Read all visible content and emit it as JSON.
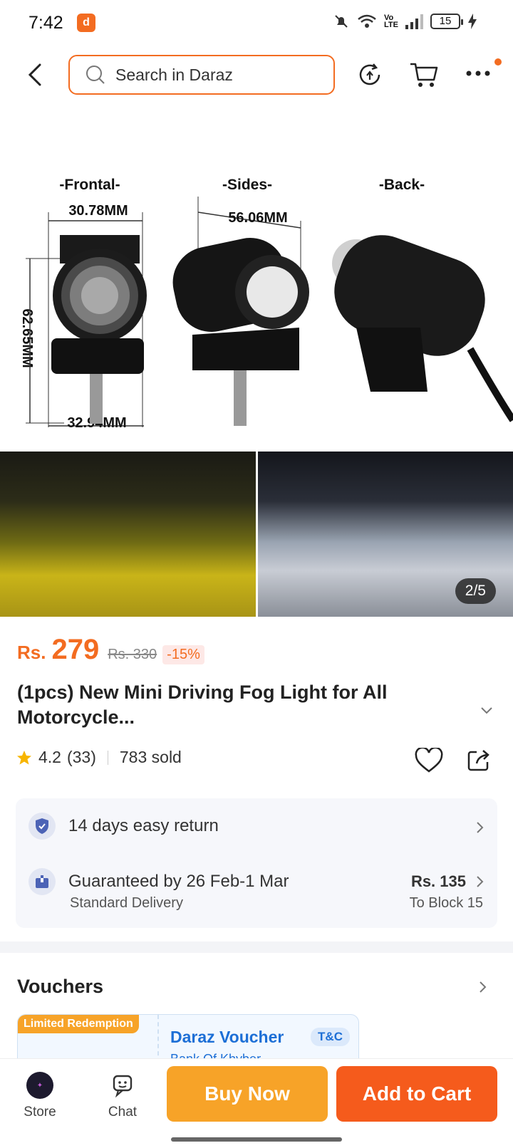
{
  "status_bar": {
    "time": "7:42",
    "battery": "15",
    "icons": [
      "mute-icon",
      "wifi-icon",
      "volte-icon",
      "signal-icon",
      "battery-icon",
      "charging-icon"
    ]
  },
  "nav": {
    "search_placeholder": "Search in Daraz",
    "icons": [
      "back-arrow-icon",
      "search-icon",
      "history-icon",
      "cart-icon",
      "more-icon"
    ]
  },
  "gallery": {
    "labels": {
      "frontal": "-Frontal-",
      "sides": "-Sides-",
      "back": "-Back-"
    },
    "dimensions": {
      "front_width": "30.78MM",
      "side_length": "56.06MM",
      "height": "62.65MM",
      "bracket_width": "32.94MM"
    },
    "counter": "2/5"
  },
  "product": {
    "currency": "Rs.",
    "price": "279",
    "old_price": "Rs. 330",
    "discount": "-15%",
    "title": "(1pcs) New Mini Driving Fog Light for All Motorcycle...",
    "rating": "4.2",
    "reviews": "(33)",
    "sold": "783 sold"
  },
  "service": {
    "return_text": "14 days easy return",
    "delivery_text": "Guaranteed by 26 Feb-1 Mar",
    "delivery_sub": "Standard Delivery",
    "delivery_fee": "Rs. 135",
    "delivery_to": "To Block 15"
  },
  "vouchers": {
    "title": "Vouchers",
    "card": {
      "tag": "Limited Redemption",
      "name": "Daraz Voucher",
      "tc": "T&C",
      "sub": "Bank Of Khyber"
    }
  },
  "bottom_bar": {
    "store_label": "Store",
    "chat_label": "Chat",
    "buy_now": "Buy Now",
    "add_to_cart": "Add to Cart"
  },
  "colors": {
    "accent": "#f36c21",
    "buy_now": "#f7a328",
    "add_to_cart": "#f55b1c",
    "voucher_blue": "#1d6fd6"
  }
}
